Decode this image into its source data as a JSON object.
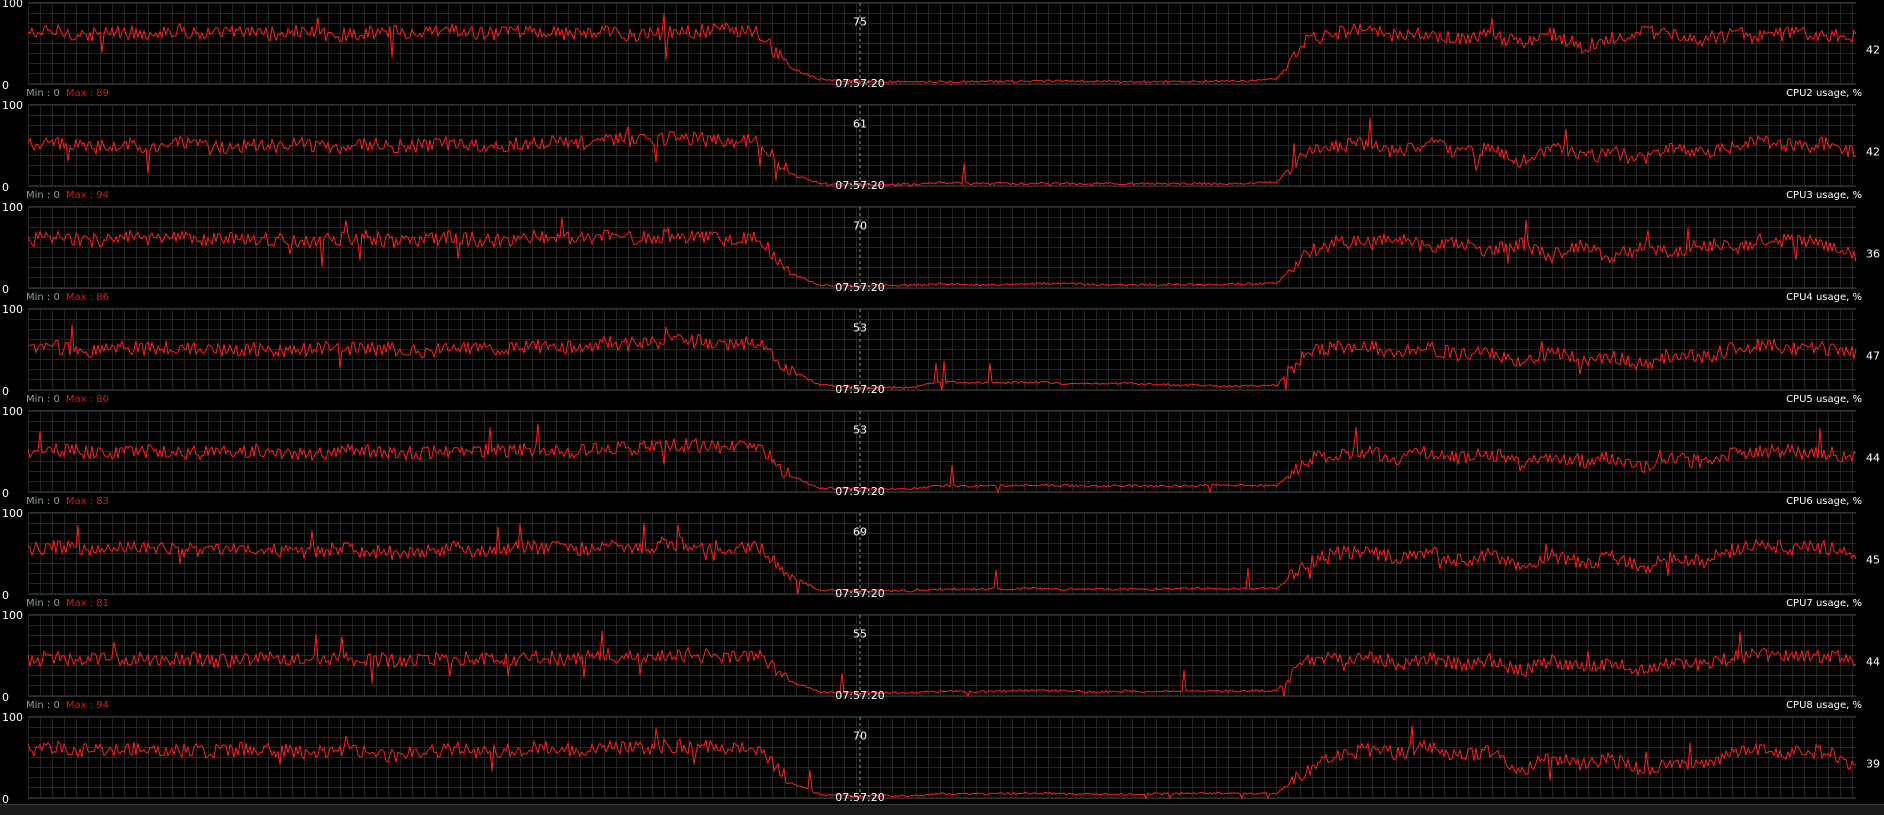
{
  "monitor": {
    "colors": {
      "line": "#ff2020",
      "grid": "#232323",
      "background": "#000000",
      "text": "#ffffff",
      "min_label": "#8aa0a8",
      "max_label": "#e01818"
    }
  },
  "chart_data": [
    {
      "type": "line",
      "ylim": [
        0,
        100
      ],
      "y_ticks": [
        "100",
        "0"
      ],
      "time_label": "07:57:20",
      "cursor_value": "75",
      "last_value": "42",
      "name": "",
      "min_label": "",
      "max_label": "",
      "profile": [
        62,
        65,
        60,
        64,
        63,
        66,
        61,
        64,
        62,
        65,
        60,
        63,
        64,
        62,
        66,
        61,
        63,
        65,
        62,
        64,
        60,
        63,
        65,
        67,
        62,
        20,
        6,
        4,
        3,
        3,
        3,
        3,
        3,
        3,
        4,
        3,
        3,
        3,
        3,
        4,
        3,
        6,
        55,
        63,
        68,
        58,
        62,
        55,
        60,
        52,
        62,
        45,
        58,
        64,
        60,
        55,
        62,
        57,
        65,
        62,
        58
      ]
    },
    {
      "type": "line",
      "ylim": [
        0,
        100
      ],
      "y_ticks": [
        "100",
        "0"
      ],
      "time_label": "07:57:20",
      "cursor_value": "61",
      "last_value": "42",
      "name": "CPU2 usage, %",
      "min_label": "Min : 0",
      "max_label": "Max : 89",
      "profile": [
        50,
        52,
        48,
        51,
        49,
        53,
        47,
        50,
        49,
        52,
        48,
        51,
        50,
        49,
        54,
        50,
        52,
        55,
        51,
        58,
        56,
        60,
        58,
        55,
        57,
        15,
        3,
        2,
        2,
        2,
        4,
        3,
        3,
        3,
        3,
        3,
        3,
        3,
        3,
        3,
        3,
        5,
        45,
        50,
        52,
        40,
        55,
        38,
        48,
        30,
        50,
        35,
        42,
        32,
        45,
        40,
        50,
        55,
        48,
        52,
        42
      ]
    },
    {
      "type": "line",
      "ylim": [
        0,
        100
      ],
      "y_ticks": [
        "100",
        "0"
      ],
      "time_label": "07:57:20",
      "cursor_value": "70",
      "last_value": "36",
      "name": "CPU3 usage, %",
      "min_label": "Min : 0",
      "max_label": "Max : 94",
      "profile": [
        60,
        62,
        58,
        63,
        60,
        61,
        59,
        62,
        60,
        57,
        61,
        63,
        58,
        60,
        62,
        59,
        61,
        63,
        60,
        64,
        62,
        65,
        63,
        60,
        62,
        18,
        4,
        3,
        3,
        3,
        5,
        4,
        4,
        5,
        6,
        4,
        4,
        4,
        4,
        4,
        5,
        6,
        45,
        58,
        55,
        62,
        50,
        58,
        45,
        55,
        40,
        52,
        38,
        50,
        42,
        55,
        48,
        60,
        58,
        55,
        40
      ]
    },
    {
      "type": "line",
      "ylim": [
        0,
        100
      ],
      "y_ticks": [
        "100",
        "0"
      ],
      "time_label": "07:57:20",
      "cursor_value": "53",
      "last_value": "47",
      "name": "CPU4 usage, %",
      "min_label": "Min : 0",
      "max_label": "Max : 86",
      "profile": [
        50,
        53,
        49,
        52,
        51,
        54,
        48,
        51,
        50,
        49,
        52,
        50,
        51,
        48,
        53,
        50,
        52,
        55,
        51,
        58,
        56,
        62,
        60,
        57,
        58,
        25,
        6,
        4,
        3,
        3,
        10,
        9,
        9,
        10,
        8,
        7,
        8,
        7,
        6,
        5,
        5,
        6,
        48,
        52,
        55,
        45,
        52,
        42,
        48,
        30,
        48,
        35,
        42,
        32,
        45,
        40,
        52,
        56,
        50,
        52,
        47
      ]
    },
    {
      "type": "line",
      "ylim": [
        0,
        100
      ],
      "y_ticks": [
        "100",
        "0"
      ],
      "time_label": "07:57:20",
      "cursor_value": "53",
      "last_value": "44",
      "name": "CPU5 usage, %",
      "min_label": "Min : 0",
      "max_label": "Max : 80",
      "profile": [
        48,
        52,
        49,
        50,
        51,
        48,
        50,
        49,
        52,
        47,
        50,
        51,
        49,
        48,
        52,
        50,
        51,
        54,
        50,
        55,
        53,
        58,
        57,
        55,
        56,
        20,
        5,
        4,
        4,
        4,
        8,
        7,
        8,
        9,
        8,
        7,
        8,
        7,
        8,
        9,
        8,
        8,
        40,
        48,
        50,
        42,
        50,
        40,
        48,
        35,
        46,
        38,
        42,
        30,
        40,
        38,
        48,
        52,
        50,
        48,
        44
      ]
    },
    {
      "type": "line",
      "ylim": [
        0,
        100
      ],
      "y_ticks": [
        "100",
        "0"
      ],
      "time_label": "07:57:20",
      "cursor_value": "69",
      "last_value": "45",
      "name": "CPU6 usage, %",
      "min_label": "Min : 0",
      "max_label": "Max : 83",
      "profile": [
        55,
        58,
        54,
        57,
        56,
        55,
        53,
        56,
        55,
        52,
        55,
        54,
        50,
        53,
        57,
        52,
        56,
        58,
        55,
        60,
        58,
        62,
        60,
        58,
        57,
        22,
        5,
        4,
        4,
        4,
        6,
        6,
        6,
        7,
        6,
        6,
        6,
        6,
        7,
        7,
        6,
        7,
        40,
        50,
        52,
        45,
        55,
        40,
        50,
        35,
        48,
        38,
        45,
        32,
        45,
        40,
        55,
        60,
        55,
        58,
        45
      ]
    },
    {
      "type": "line",
      "ylim": [
        0,
        100
      ],
      "y_ticks": [
        "100",
        "0"
      ],
      "time_label": "07:57:20",
      "cursor_value": "55",
      "last_value": "44",
      "name": "CPU7 usage, %",
      "min_label": "Min : 0",
      "max_label": "Max : 81",
      "profile": [
        45,
        47,
        44,
        46,
        45,
        47,
        43,
        45,
        46,
        44,
        45,
        46,
        44,
        43,
        47,
        45,
        46,
        48,
        45,
        50,
        48,
        52,
        50,
        48,
        49,
        18,
        5,
        4,
        4,
        4,
        6,
        5,
        6,
        7,
        6,
        5,
        6,
        5,
        6,
        6,
        6,
        7,
        42,
        48,
        50,
        40,
        48,
        38,
        45,
        30,
        45,
        35,
        42,
        30,
        42,
        38,
        48,
        52,
        48,
        50,
        44
      ]
    },
    {
      "type": "line",
      "ylim": [
        0,
        100
      ],
      "y_ticks": [
        "100",
        "0"
      ],
      "time_label": "07:57:20",
      "cursor_value": "70",
      "last_value": "39",
      "name": "CPU8 usage, %",
      "min_label": "Min : 0",
      "max_label": "Max : 94",
      "profile": [
        60,
        62,
        58,
        61,
        60,
        59,
        57,
        60,
        59,
        56,
        59,
        58,
        52,
        57,
        61,
        56,
        60,
        62,
        59,
        63,
        61,
        65,
        63,
        61,
        62,
        20,
        4,
        3,
        3,
        3,
        5,
        5,
        5,
        6,
        5,
        5,
        5,
        5,
        6,
        6,
        5,
        6,
        35,
        52,
        60,
        55,
        65,
        50,
        58,
        35,
        50,
        40,
        48,
        32,
        45,
        38,
        55,
        60,
        55,
        58,
        39
      ]
    }
  ]
}
